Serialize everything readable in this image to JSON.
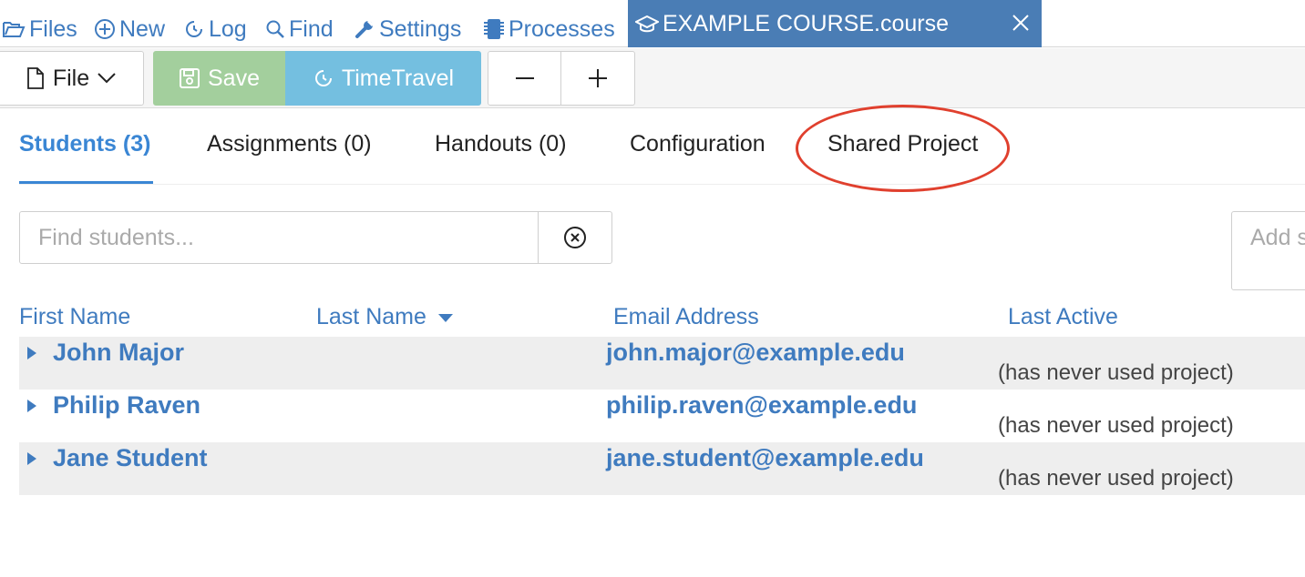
{
  "nav": {
    "files": "Files",
    "new": "New",
    "log": "Log",
    "find": "Find",
    "settings": "Settings",
    "processes": "Processes",
    "active_tab": "EXAMPLE COURSE.course",
    "active_tab_bg": "#4a7db5"
  },
  "toolbar": {
    "file": "File",
    "save": "Save",
    "timetravel": "TimeTravel",
    "zoom_out": "−",
    "zoom_in": "+"
  },
  "subtabs": {
    "students": "Students (3)",
    "assignments": "Assignments (0)",
    "handouts": "Handouts (0)",
    "configuration": "Configuration",
    "shared_project": "Shared Project",
    "active_color": "#3a86d4"
  },
  "search": {
    "placeholder": "Find students...",
    "add_placeholder": "Add s"
  },
  "table": {
    "headers": {
      "first_name": "First Name",
      "last_name": "Last Name",
      "email": "Email Address",
      "last_active": "Last Active"
    },
    "rows": [
      {
        "name": "John Major",
        "email": "john.major@example.edu",
        "last_active": "(has never used project)"
      },
      {
        "name": "Philip Raven",
        "email": "philip.raven@example.edu",
        "last_active": "(has never used project)"
      },
      {
        "name": "Jane Student",
        "email": "jane.student@example.edu",
        "last_active": "(has never used project)"
      }
    ]
  },
  "colors": {
    "link": "#3f7bbf",
    "save_green": "#a3cf9d",
    "timetravel_blue": "#74bfe0",
    "annotation_red": "#e0402e"
  }
}
